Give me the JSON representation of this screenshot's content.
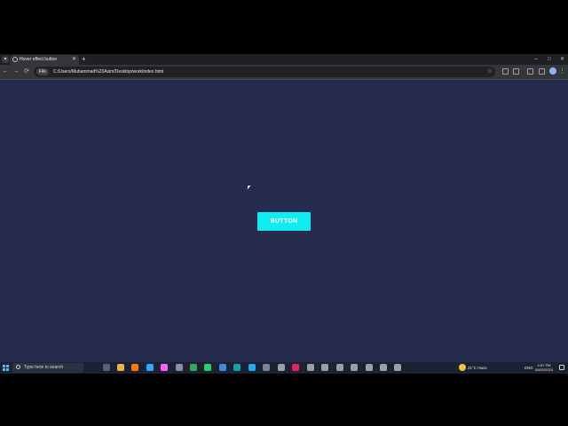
{
  "browser": {
    "tab": {
      "title": "Hover effect button"
    },
    "address_bar": {
      "site_chip": "File",
      "url": "C:/Users/Muhammad%20Asim/Desktop/work/index.html"
    },
    "icons": {
      "new_tab": "+",
      "minimize": "–",
      "maximize": "□",
      "close": "✕",
      "back": "←",
      "forward": "→",
      "reload": "⟳",
      "bookmark": "☆",
      "menu": "⋮"
    }
  },
  "page": {
    "background_color": "#262c4e",
    "button": {
      "label": "BUTTON",
      "color": "#11ecf2"
    }
  },
  "taskbar": {
    "search_placeholder": "Type here to search",
    "weather": "21°C  Haze",
    "language": "ENG",
    "time": "4:57 PM",
    "date": "05/02/2024"
  }
}
